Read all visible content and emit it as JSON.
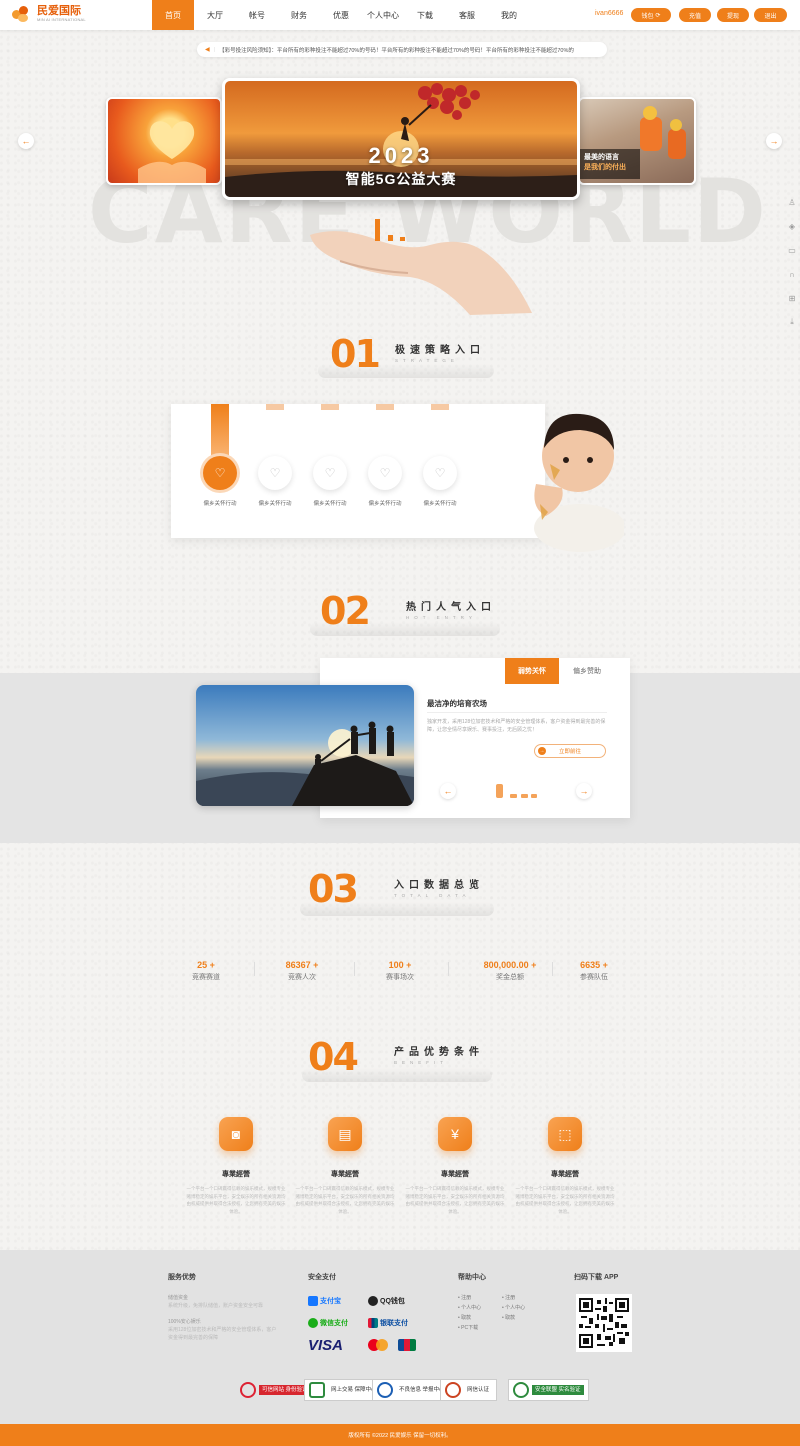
{
  "brand": {
    "name": "民爱国际",
    "sub": "MIN AI INTERNATIONAL"
  },
  "nav": [
    "首页",
    "大厅",
    "帐号",
    "财务",
    "优惠",
    "个人中心",
    "下载",
    "客服",
    "我的"
  ],
  "header": {
    "username": "ivan6666",
    "wallet": "钱包",
    "deposit": "充值",
    "withdraw": "提现",
    "logout": "退出"
  },
  "notice": {
    "text": "【彩号投注风险须知】：平台所有的彩种投注不能超过70%的号码！平台所有的彩种投注不能超过70%的号码！平台所有的彩种投注不能超过70%的"
  },
  "banner": {
    "bg_word": "CARE WORLD",
    "main_title": "2023",
    "main_subtitle": "智能5G公益大赛",
    "right_caption1": "最美的语言",
    "right_caption2": "是我们的付出"
  },
  "section1": {
    "num": "01",
    "title": "极速策略入口",
    "sub": "STRATEGE",
    "items": [
      "偏乡关怀行动",
      "偏乡关怀行动",
      "偏乡关怀行动",
      "偏乡关怀行动",
      "偏乡关怀行动"
    ]
  },
  "section2": {
    "num": "02",
    "title": "热门人气入口",
    "sub": "HOT ENTRY",
    "tabs": [
      "弱势关怀",
      "偏乡赞助"
    ],
    "article_title": "最洁净的培育农场",
    "article_desc": "独家开发，采用128位加密技术和严格的安全管理体系，客户资金得到最完善的保障，让您全情尽享娱乐、赛事投注，无后顾之忧！",
    "go_label": "立即前往"
  },
  "section3": {
    "num": "03",
    "title": "入口数据总览",
    "sub": "TOTAL DATA",
    "stats": [
      {
        "value": "25 +",
        "label": "竞赛赛道"
      },
      {
        "value": "86367 +",
        "label": "竞赛人次"
      },
      {
        "value": "100 +",
        "label": "赛事场次"
      },
      {
        "value": "800,000.00 +",
        "label": "奖金总额"
      },
      {
        "value": "6635 +",
        "label": "参赛队伍"
      }
    ]
  },
  "section4": {
    "num": "04",
    "title": "产品优势条件",
    "sub": "BENEFIT",
    "features": [
      {
        "icon": "camera-icon",
        "title": "專業經營",
        "desc": "一个平台一个口碑赢得信赖的娱乐模式，规模专业赌博稳定的娱乐平台，安全娱乐的所有相关资源均由权威提供并取得合法授权，让您拥有完美的娱乐体验。"
      },
      {
        "icon": "card-icon",
        "title": "專業經營",
        "desc": "一个平台一个口碑赢得信赖的娱乐模式，规模专业赌博稳定的娱乐平台，安全娱乐的所有相关资源均由权威提供并取得合法授权，让您拥有完美的娱乐体验。"
      },
      {
        "icon": "yen-icon",
        "title": "專業經營",
        "desc": "一个平台一个口碑赢得信赖的娱乐模式，规模专业赌博稳定的娱乐平台，安全娱乐的所有相关资源均由权威提供并取得合法授权，让您拥有完美的娱乐体验。"
      },
      {
        "icon": "chart-icon",
        "title": "專業經營",
        "desc": "一个平台一个口碑赢得信赖的娱乐模式，规模专业赌博稳定的娱乐平台，安全娱乐的所有相关资源均由权威提供并取得合法授权，让您拥有完美的娱乐体验。"
      }
    ]
  },
  "footer": {
    "service_head": "服务优势",
    "service_items": [
      {
        "title": "储值资金",
        "desc": "系统升级，免排队储值，账户资金安全可靠"
      },
      {
        "title": "100%安心娱乐",
        "desc": "采用128位加密技术和严格的安全管理体系，客户资金得到最完善的保障"
      }
    ],
    "pay_head": "安全支付",
    "pays": [
      "支付宝",
      "QQ钱包",
      "微信支付",
      "银联支付",
      "VISA"
    ],
    "help_head": "帮助中心",
    "help_links": [
      "注册",
      "注册",
      "个人中心",
      "个人中心",
      "取款",
      "取款",
      "PC下载"
    ],
    "app_head": "扫码下载 APP",
    "badges": [
      "可信网站 身份验证",
      "网上交易 保障中心",
      "不良信息 举报中心",
      "网信认证",
      "安全联盟 实名验证"
    ],
    "copyright": "版权所有 ©2022 民爱娱乐 保留一切权利。"
  },
  "colors": {
    "accent": "#ef7f1a"
  }
}
